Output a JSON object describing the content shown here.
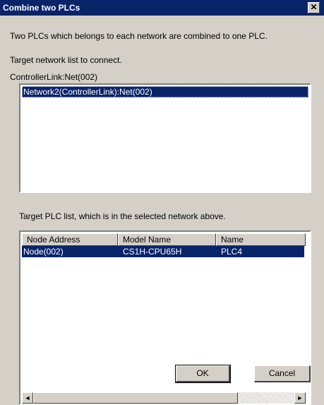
{
  "window": {
    "title": "Combine two PLCs",
    "close_label": "✕"
  },
  "description": "Two PLCs which belongs to each network are combined to one PLC.",
  "network_section": {
    "caption": "Target network list to connect.",
    "current_network": "ControllerLink:Net(002)",
    "items": [
      "Network2(ControllerLink):Net(002)"
    ]
  },
  "plc_section": {
    "caption": "Target PLC list, which is in the selected network above.",
    "columns": [
      "Node Address",
      "Model Name",
      "Name"
    ],
    "rows": [
      [
        "Node(002)",
        "CS1H-CPU65H",
        "PLC4"
      ]
    ]
  },
  "scrollbar": {
    "left_arrow": "◄",
    "right_arrow": "►"
  },
  "buttons": {
    "ok": "OK",
    "cancel": "Cancel"
  },
  "colors": {
    "title_bar": "#0a246a",
    "selection": "#0a246a",
    "face": "#d4d0c8"
  }
}
